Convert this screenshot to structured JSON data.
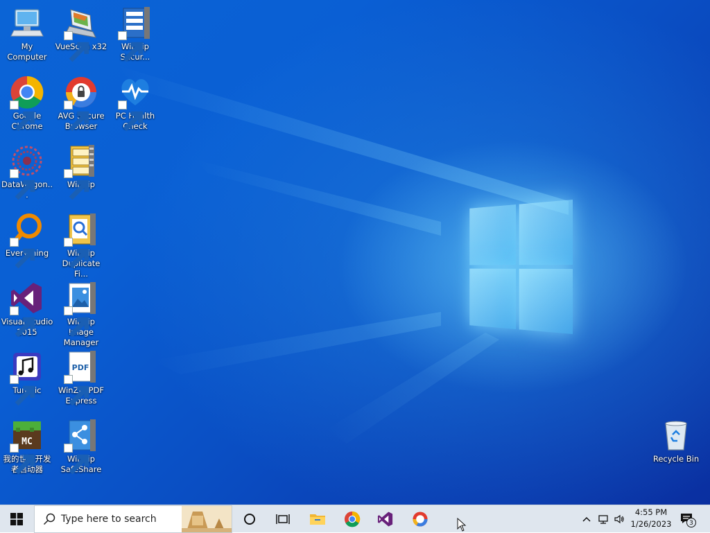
{
  "desktop": {
    "icons": [
      {
        "name": "my-computer",
        "label": "My Computer"
      },
      {
        "name": "vuescan",
        "label": "VueScan x32"
      },
      {
        "name": "winzip-secure",
        "label": "WinZip Secur..."
      },
      {
        "name": "google-chrome",
        "label": "Google Chrome"
      },
      {
        "name": "avg-secure-browser",
        "label": "AVG Secure Browser"
      },
      {
        "name": "pc-health-check",
        "label": "PC Health Check"
      },
      {
        "name": "datawagon",
        "label": "DataWagon..."
      },
      {
        "name": "winzip",
        "label": "WinZip"
      },
      {
        "name": "everything",
        "label": "Everything"
      },
      {
        "name": "winzip-duplicate",
        "label": "WinZip Duplicate Fi..."
      },
      {
        "name": "visual-studio",
        "label": "Visual Studio 2015"
      },
      {
        "name": "winzip-image",
        "label": "WinZip Image Manager"
      },
      {
        "name": "tunatic",
        "label": "Tunatic"
      },
      {
        "name": "winzip-pdf",
        "label": "WinZip PDF Express"
      },
      {
        "name": "mc-launcher",
        "label": "我的世界开发者启动器"
      },
      {
        "name": "winzip-safeshare",
        "label": "WinZip SafeShare"
      },
      {
        "name": "recycle-bin",
        "label": "Recycle Bin"
      }
    ]
  },
  "taskbar": {
    "search_placeholder": "Type here to search",
    "pinned": [
      "cortana-icon",
      "task-view-icon",
      "file-explorer-icon",
      "chrome-icon",
      "visual-studio-icon",
      "avg-browser-icon"
    ],
    "clock_time": "4:55 PM",
    "clock_date": "1/26/2023",
    "notification_count": "3"
  },
  "colors": {
    "desktop_blue": "#0a5fd4",
    "taskbar_bg": "#dfe6ee",
    "vs_purple": "#68217a"
  }
}
